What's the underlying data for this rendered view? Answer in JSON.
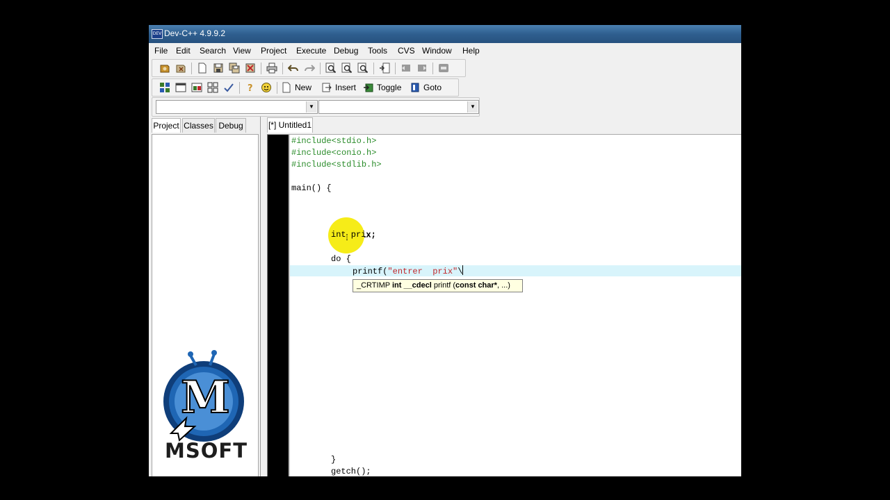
{
  "window": {
    "title": "Dev-C++ 4.9.9.2",
    "app_icon": "devcpp-icon"
  },
  "menu": [
    "File",
    "Edit",
    "Search",
    "View",
    "Project",
    "Execute",
    "Debug",
    "Tools",
    "CVS",
    "Window",
    "Help"
  ],
  "toolbar2": {
    "new_label": "New",
    "insert_label": "Insert",
    "toggle_label": "Toggle",
    "goto_label": "Goto"
  },
  "combos": {
    "left_value": "",
    "right_value": ""
  },
  "left_tabs": [
    "Project",
    "Classes",
    "Debug"
  ],
  "editor_tab": "[*] Untitled1",
  "code": {
    "line1": "#include<stdio.h>",
    "line2": "#include<conio.h>",
    "line3": "#include<stdlib.h>",
    "line4": "main() {",
    "line5": "int prix;",
    "line6": "do {",
    "line7_fn": "printf(",
    "line7_str": "\"entrer  prix\"",
    "line7_tail": "\\",
    "line8": "}",
    "line9": "getch();"
  },
  "tooltip": {
    "pre": "_CRTIMP ",
    "b1": "int __cdecl",
    "mid": " printf (",
    "b2": "const char*",
    "post": ", ...)"
  },
  "watermark": {
    "text": "MSOFT",
    "letter": "M"
  },
  "colors": {
    "title_bar": "#2f5f8f",
    "gutter": "#000000",
    "current_line": "#d8f4fb",
    "include_green": "#2a8c2a",
    "string_red": "#c0262a",
    "tooltip_bg": "#ffffe1",
    "cursor_highlight": "#f6ec18"
  }
}
